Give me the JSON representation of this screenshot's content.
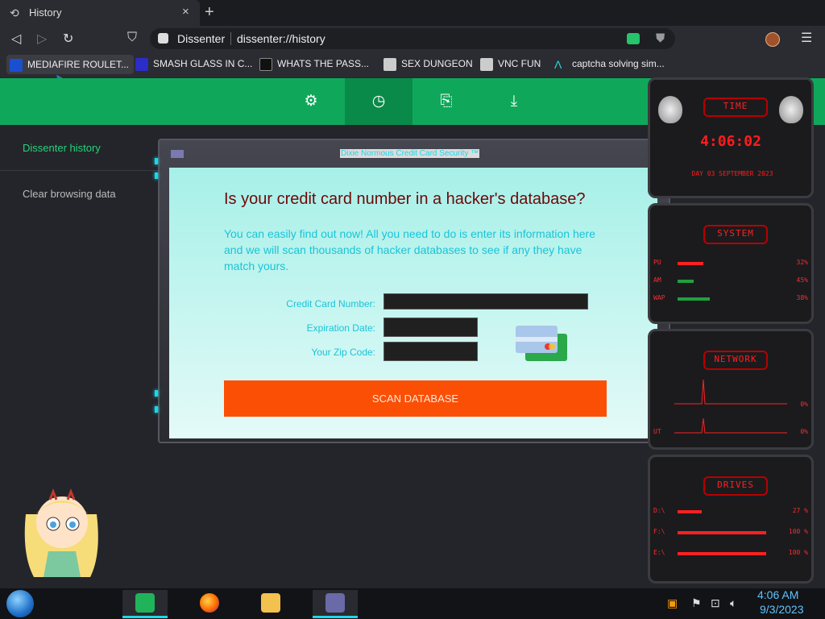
{
  "tab": {
    "title": "History",
    "close": "×",
    "new_tab": "+"
  },
  "toolbar": {
    "back": "◁",
    "forward": "▷",
    "reload": "↻",
    "bookmark": "⛉",
    "site_name": "Dissenter",
    "url": "dissenter://history",
    "menu": "☰"
  },
  "bookmarks": [
    {
      "label": "MEDIAFIRE ROULET...",
      "icon_color": "#1a4fd1"
    },
    {
      "label": "SMASH GLASS IN C...",
      "icon_color": "#2c2cc8"
    },
    {
      "label": "WHATS THE PASS...",
      "icon_color": "#111111"
    },
    {
      "label": "SEX DUNGEON",
      "icon_color": "#cccccc"
    },
    {
      "label": "VNC FUN",
      "icon_color": "#cccccc"
    },
    {
      "label": "captcha solving sim...",
      "icon_color": "#1fd7e6"
    }
  ],
  "dissenter": {
    "nav_icons": [
      "gear-icon",
      "history-icon",
      "bookmark-icon",
      "download-icon"
    ],
    "sidebar": {
      "history": "Dissenter history",
      "clear": "Clear browsing data"
    }
  },
  "popup": {
    "title": "Dixie Normous Credit Card Security ™",
    "heading": "Is your credit card number in a hacker's database?",
    "description": "You can easily find out now! All you need to do is enter its information here and we will scan thousands of hacker databases to see if any they have match yours.",
    "fields": {
      "card_number_label": "Credit Card Number:",
      "expiration_label": "Expiration Date:",
      "zip_label": "Your Zip Code:",
      "card_number_value": "",
      "expiration_value": "",
      "zip_value": ""
    },
    "button": "SCAN DATABASE"
  },
  "gadget": {
    "time_title": "TIME",
    "time": "4:06:02",
    "date": "DAY 03 SEPTEMBER 2023",
    "system_title": "SYSTEM",
    "system_rows": [
      {
        "label": "PU",
        "value": "32%"
      },
      {
        "label": "AM",
        "value": "45%"
      },
      {
        "label": "WAP",
        "value": "38%"
      }
    ],
    "network_title": "NETWORK",
    "network_rows": [
      {
        "label": "",
        "value": "0%"
      },
      {
        "label": "UT",
        "value": "0%"
      }
    ],
    "drives_title": "DRIVES",
    "drive_rows": [
      {
        "label": "D:\\",
        "value": "27 %"
      },
      {
        "label": "F:\\",
        "value": "100 %"
      },
      {
        "label": "E:\\",
        "value": "100 %"
      }
    ]
  },
  "taskbar": {
    "time": "4:06 AM",
    "date": "9/3/2023"
  }
}
